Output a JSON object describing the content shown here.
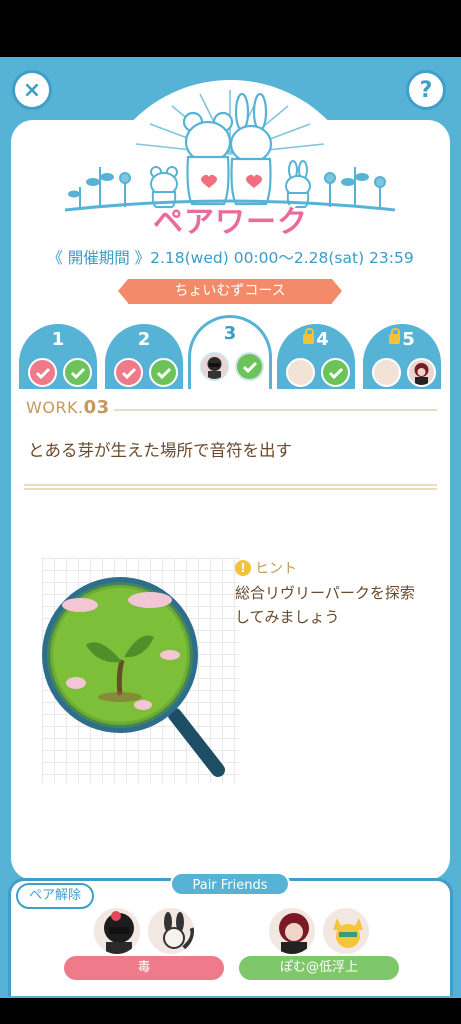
{
  "header": {
    "title": "ペアワーク",
    "period": "《 開催期間 》2.18(wed) 00:00〜2.28(sat) 23:59",
    "course": "ちょいむずコース"
  },
  "buttons": {
    "close": "×",
    "help": "?"
  },
  "tabs": [
    {
      "number": "1",
      "locked": false,
      "state": "done"
    },
    {
      "number": "2",
      "locked": false,
      "state": "done"
    },
    {
      "number": "3",
      "locked": false,
      "state": "active"
    },
    {
      "number": "4",
      "locked": true,
      "state": "locked"
    },
    {
      "number": "5",
      "locked": true,
      "state": "locked"
    }
  ],
  "work": {
    "label": "WORK.",
    "number": "03",
    "task": "とある芽が生えた場所で音符を出す"
  },
  "hint": {
    "label": "ヒント",
    "icon": "!",
    "text": "総合リヴリーパークを探索してみましょう"
  },
  "pair_friends": {
    "title": "Pair Friends",
    "unpair_label": "ペア解除",
    "pairs": [
      {
        "name": "毒"
      },
      {
        "name": "ぽむ@低浮上"
      }
    ]
  },
  "colors": {
    "sky": "#57b3d6",
    "pink": "#ee7a8a",
    "green": "#6cc35a",
    "coral": "#f38b6b"
  }
}
